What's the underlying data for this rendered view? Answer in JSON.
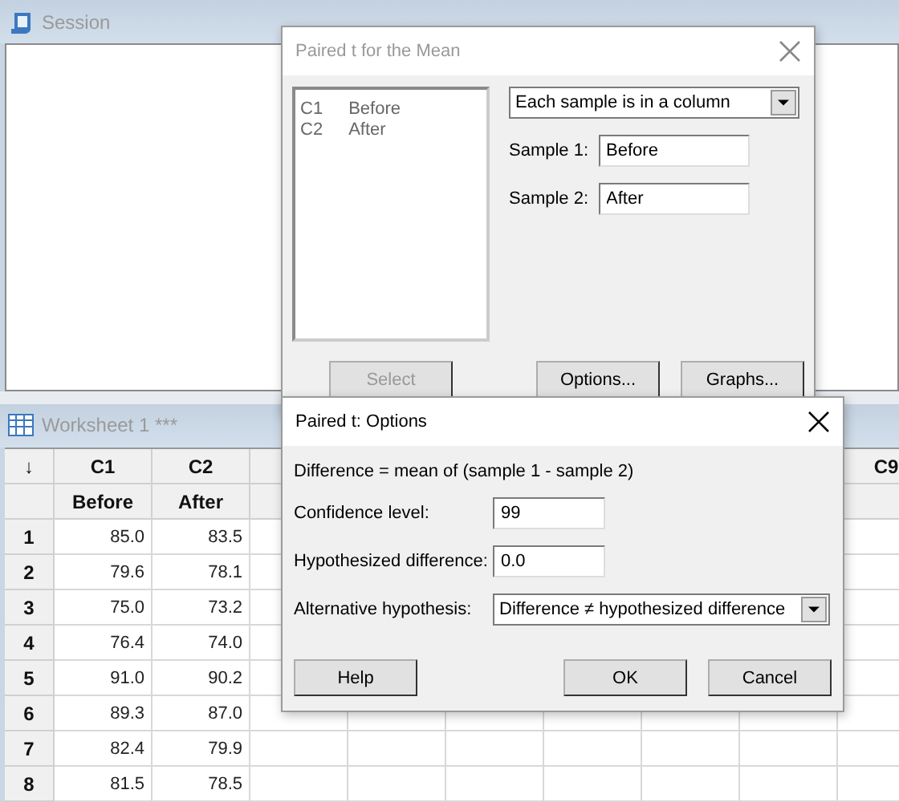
{
  "session": {
    "title": "Session"
  },
  "worksheet": {
    "title": "Worksheet 1 ***",
    "corner": "↓",
    "columns": [
      {
        "header": "C1",
        "name": "Before"
      },
      {
        "header": "C2",
        "name": "After"
      }
    ],
    "column_9": {
      "header": "C9"
    },
    "rows": [
      {
        "number": "1",
        "values": [
          "85.0",
          "83.5"
        ]
      },
      {
        "number": "2",
        "values": [
          "79.6",
          "78.1"
        ]
      },
      {
        "number": "3",
        "values": [
          "75.0",
          "73.2"
        ]
      },
      {
        "number": "4",
        "values": [
          "76.4",
          "74.0"
        ]
      },
      {
        "number": "5",
        "values": [
          "91.0",
          "90.2"
        ]
      },
      {
        "number": "6",
        "values": [
          "89.3",
          "87.0"
        ]
      },
      {
        "number": "7",
        "values": [
          "82.4",
          "79.9"
        ]
      },
      {
        "number": "8",
        "values": [
          "81.5",
          "78.5"
        ]
      }
    ]
  },
  "paired_t_dialog": {
    "title": "Paired t for the Mean",
    "active": false,
    "variables": [
      {
        "column": "C1",
        "name": "Before"
      },
      {
        "column": "C2",
        "name": "After"
      }
    ],
    "layout_select": "Each sample is in a column",
    "fields": [
      {
        "label": "Sample 1:",
        "value": "Before"
      },
      {
        "label": "Sample 2:",
        "value": "After"
      }
    ],
    "buttons": [
      {
        "label": "Select",
        "disabled": true
      },
      {
        "label": "Options...",
        "disabled": false
      },
      {
        "label": "Graphs...",
        "disabled": false
      }
    ]
  },
  "options_dialog": {
    "title": "Paired t: Options",
    "active": true,
    "note": "Difference = mean of (sample 1 - sample 2)",
    "fields": [
      {
        "kind": "input",
        "label": "Confidence level:",
        "value": "99"
      },
      {
        "kind": "input",
        "label": "Hypothesized difference:",
        "value": "0.0"
      },
      {
        "kind": "select",
        "label": "Alternative hypothesis:",
        "value": "Difference ≠ hypothesized difference"
      }
    ],
    "buttons": [
      {
        "label": "Help"
      },
      {
        "label": "OK"
      },
      {
        "label": "Cancel"
      }
    ]
  }
}
